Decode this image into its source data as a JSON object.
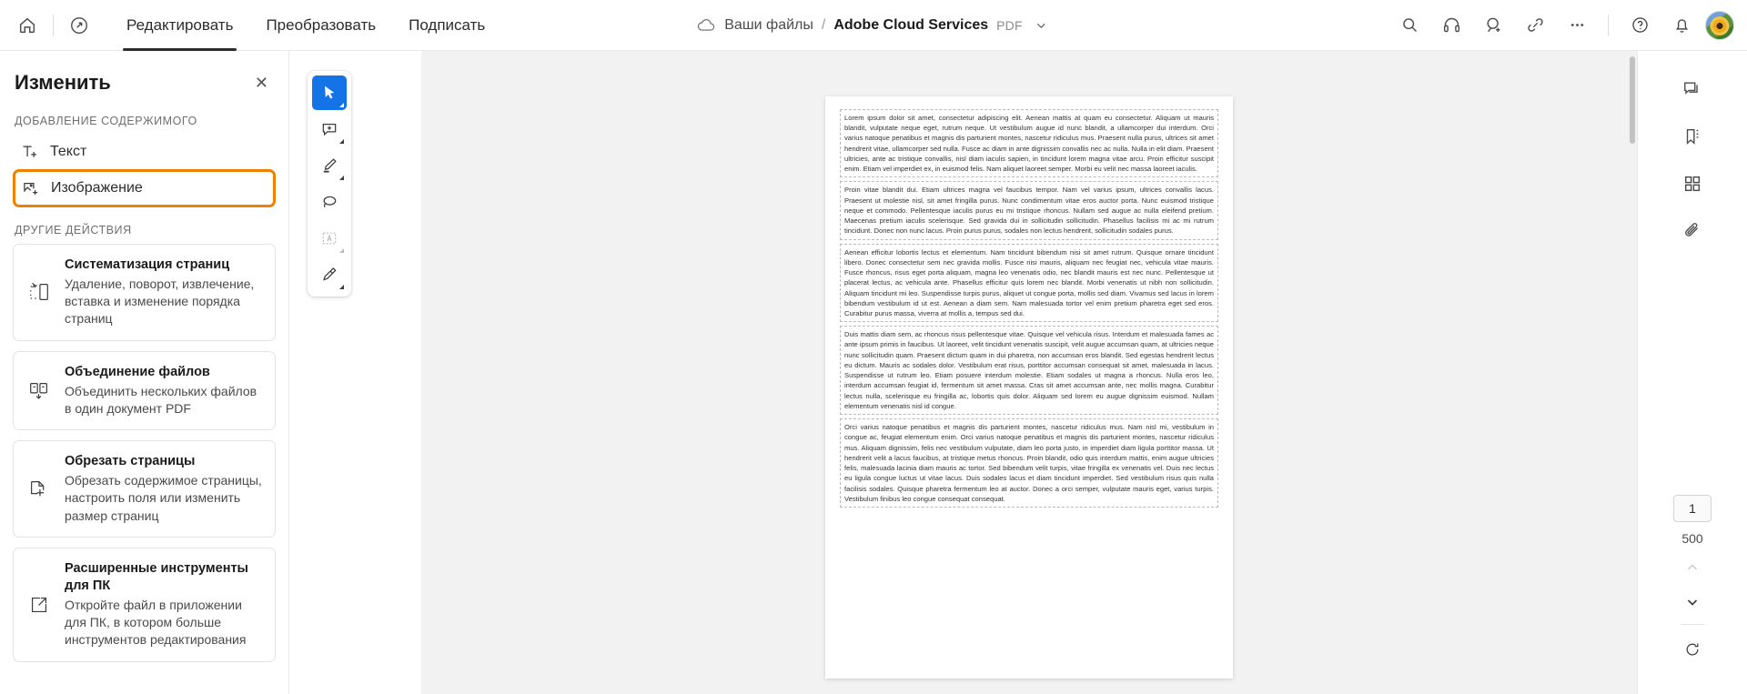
{
  "topbar": {
    "home_icon": "home-icon",
    "app_icon": "acrobat-logo-icon",
    "tabs": [
      {
        "label": "Редактировать",
        "active": true
      },
      {
        "label": "Преобразовать",
        "active": false
      },
      {
        "label": "Подписать",
        "active": false
      }
    ],
    "breadcrumb": {
      "cloud_icon": "cloud-icon",
      "root": "Ваши файлы",
      "separator": "/",
      "title": "Adobe Cloud Services",
      "badge": "PDF",
      "chevron": "chevron-down-icon"
    },
    "actions": [
      {
        "name": "search-icon",
        "label": "Поиск"
      },
      {
        "name": "headphones-icon",
        "label": "Прослушать"
      },
      {
        "name": "add-person-icon",
        "label": "Пригласить"
      },
      {
        "name": "link-icon",
        "label": "Ссылка"
      },
      {
        "name": "more-icon",
        "label": "..."
      },
      {
        "name": "help-icon",
        "label": "Справка"
      },
      {
        "name": "bell-icon",
        "label": "Уведомления"
      }
    ],
    "avatar_name": "user-avatar"
  },
  "left_panel": {
    "title": "Изменить",
    "close_label": "✕",
    "add_section_label": "ДОБАВЛЕНИЕ СОДЕРЖИМОГО",
    "add_items": [
      {
        "label": "Текст",
        "icon": "add-text-icon",
        "highlighted": false
      },
      {
        "label": "Изображение",
        "icon": "add-image-icon",
        "highlighted": true
      }
    ],
    "other_section_label": "ДРУГИЕ ДЕЙСТВИЯ",
    "cards": [
      {
        "icon": "organize-pages-icon",
        "title": "Систематизация страниц",
        "desc": "Удаление, поворот, извлечение, вставка и изменение порядка страниц"
      },
      {
        "icon": "combine-files-icon",
        "title": "Объединение файлов",
        "desc": "Объединить нескольких файлов в один документ PDF"
      },
      {
        "icon": "crop-pages-icon",
        "title": "Обрезать страницы",
        "desc": "Обрезать содержимое страницы, настроить поля или изменить размер страниц"
      },
      {
        "icon": "open-desktop-icon",
        "title": "Расширенные инструменты для ПК",
        "desc": "Откройте файл в приложении для ПК, в котором больше инструментов редактирования"
      }
    ]
  },
  "toolstrip": {
    "tools": [
      {
        "name": "select-tool",
        "selected": true,
        "disabled": false,
        "caret": true
      },
      {
        "name": "add-comment-tool",
        "selected": false,
        "disabled": false,
        "caret": true
      },
      {
        "name": "highlighter-tool",
        "selected": false,
        "disabled": false,
        "caret": true
      },
      {
        "name": "lasso-tool",
        "selected": false,
        "disabled": false,
        "caret": false
      },
      {
        "name": "add-text-box-tool",
        "selected": false,
        "disabled": true,
        "caret": true
      },
      {
        "name": "signature-tool",
        "selected": false,
        "disabled": false,
        "caret": true
      }
    ]
  },
  "right_rail": {
    "buttons": [
      {
        "name": "comments-icon"
      },
      {
        "name": "bookmarks-icon"
      },
      {
        "name": "thumbnails-icon"
      },
      {
        "name": "attachments-icon"
      }
    ],
    "page_current": "1",
    "page_total": "500",
    "prev_icon": "chevron-up-icon",
    "next_icon": "chevron-down-icon",
    "rotate_icon": "rotate-icon"
  },
  "document": {
    "paragraphs": [
      "Lorem ipsum dolor sit amet, consectetur adipiscing elit. Aenean mattis at quam eu consectetur. Aliquam ut mauris blandit, vulputate neque eget, rutrum neque. Ut vestibulum augue id nunc blandit, a ullamcorper dui interdum. Orci varius natoque penatibus et magnis dis parturient montes, nascetur ridiculus mus. Praesent nulla purus, ultrices sit amet hendrerit vitae, ullamcorper sed nulla. Fusce ac diam in ante dignissim convallis nec ac nulla. Nulla in elit diam. Praesent ultricies, ante ac tristique convallis, nisl diam iaculis sapien, in tincidunt lorem magna vitae arcu. Proin efficitur suscipit enim. Etiam vel imperdiet ex, in euismod felis. Nam aliquet laoreet semper. Morbi eu velit nec massa laoreet iaculis.",
      "Proin vitae blandit dui. Etiam ultrices magna vel faucibus tempor. Nam vel varius ipsum, ultrices convallis lacus. Praesent ut molestie nisl, sit amet fringilla purus. Nunc condimentum vitae eros auctor porta. Nunc euismod tristique neque et commodo. Pellentesque iaculis purus eu mi tristique rhoncus. Nullam sed augue ac nulla eleifend pretium. Maecenas pretium iaculis scelerisque. Sed gravida dui in sollicitudin sollicitudin. Phasellus facilisis mi ac mi rutrum tincidunt. Donec non nunc lacus. Proin purus purus, sodales non lectus hendrerit, sollicitudin sodales purus.",
      "Aenean efficitur lobortis lectus et elementum. Nam tincidunt bibendum nisi sit amet rutrum. Quisque ornare tincidunt libero. Donec consectetur sem nec gravida mollis. Fusce nisi mauris, aliquam nec feugiat nec, vehicula vitae mauris. Fusce rhoncus, risus eget porta aliquam, magna leo venenatis odio, nec blandit mauris est nec nunc. Pellentesque ut placerat lectus, ac vehicula ante. Phasellus efficitur quis lorem nec blandit. Morbi venenatis ut nibh non sollicitudin. Aliquam tincidunt mi leo. Suspendisse turpis purus, aliquet ut congue porta, mollis sed diam. Vivamus sed lacus in lorem bibendum vestibulum id ut est. Aenean a diam sem. Nam malesuada tortor vel enim pretium pharetra eget sed eros. Curabitur purus massa, viverra at mollis a, tempus sed dui.",
      "Duis mattis diam sem, ac rhoncus risus pellentesque vitae. Quisque vel vehicula risus. Interdum et malesuada fames ac ante ipsum primis in faucibus. Ut laoreet, velit tincidunt venenatis suscipit, velit augue accumsan quam, at ultricies neque nunc sollicitudin quam. Praesent dictum quam in dui pharetra, non accumsan eros blandit. Sed egestas hendrerit lectus eu dictum. Mauris ac sodales dolor. Vestibulum erat risus, porttitor accumsan consequat sit amet, malesuada in lacus. Suspendisse ut rutrum leo. Etiam posuere interdum molestie. Etiam sodales ut magna a rhoncus. Nulla eros leo, interdum accumsan feugiat id, fermentum sit amet massa. Cras sit amet accumsan ante, nec mollis magna. Curabitur lectus nulla, scelerisque eu fringilla ac, lobortis quis dolor. Aliquam sed lorem eu augue dignissim euismod. Nullam elementum venenatis nisl id congue.",
      "Orci varius natoque penatibus et magnis dis parturient montes, nascetur ridiculus mus. Nam nisl mi, vestibulum in congue ac, feugiat elementum enim. Orci varius natoque penatibus et magnis dis parturient montes, nascetur ridiculus mus. Aliquam dignissim, felis nec vestibulum vulputate, diam leo porta justo, in imperdiet diam ligula porttitor massa. Ut hendrerit velit a lacus faucibus, at tristique metus rhoncus. Proin blandit, odio quis interdum mattis, enim augue ultricies felis, malesuada lacinia diam mauris ac tortor. Sed bibendum velit turpis, vitae fringilla ex venenatis vel. Duis nec lectus eu ligula congue luctus ut vitae lacus. Duis sodales lacus et diam tincidunt imperdiet. Sed vestibulum risus quis nulla facilisis sodales. Quisque pharetra fermentum leo at auctor. Donec a orci semper, vulputate mauris eget, varius turpis. Vestibulum finibus leo congue consequat consequat."
    ]
  },
  "colors": {
    "accent_blue": "#1473e6",
    "highlight_orange": "#f08000",
    "canvas_gray": "#f2f2f2"
  }
}
